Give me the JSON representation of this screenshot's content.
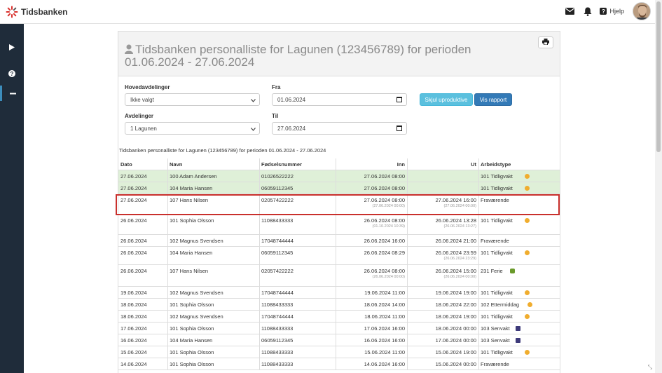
{
  "header": {
    "brand": "Tidsbanken",
    "help_label": "Hjelp",
    "icons": [
      "envelope-icon",
      "bell-icon",
      "question-icon"
    ]
  },
  "sidebar": {
    "icons": [
      "play-icon",
      "question-circle-icon",
      "minus-icon"
    ]
  },
  "report": {
    "title_line1": "Tidsbanken personalliste for Lagunen (123456789) for perioden",
    "title_line2": "01.06.2024 - 27.06.2024",
    "caption": "Tidsbanken personalliste for Lagunen (123456789) for perioden 01.06.2024 - 27.06.2024"
  },
  "filters": {
    "hoved_label": "Hovedavdelinger",
    "hoved_value": "Ikke valgt",
    "avd_label": "Avdelinger",
    "avd_value": "1 Lagunen",
    "fra_label": "Fra",
    "fra_value": "01.06.2024",
    "til_label": "Til",
    "til_value": "27.06.2024",
    "btn_hide": "Skjul uproduktive",
    "btn_show": "Vis rapport"
  },
  "table": {
    "headers": {
      "dato": "Dato",
      "navn": "Navn",
      "fnr": "Fødselsnummer",
      "inn": "Inn",
      "ut": "Ut",
      "type": "Arbeidstype"
    },
    "rows": [
      {
        "dato": "27.06.2024",
        "navn": "100 Adam Andersen",
        "fnr": "01026522222",
        "inn": "27.06.2024 08:00",
        "inn_sub": "",
        "ut": "",
        "ut_sub": "",
        "type": "101 Tidligvakt",
        "emoji": "sun-icon",
        "green": true
      },
      {
        "dato": "27.06.2024",
        "navn": "104 Maria Hansen",
        "fnr": "06059112345",
        "inn": "27.06.2024 08:00",
        "inn_sub": "",
        "ut": "",
        "ut_sub": "",
        "type": "101 Tidligvakt",
        "emoji": "sun-icon",
        "green": true
      },
      {
        "dato": "27.06.2024",
        "navn": "107 Hans Nilsen",
        "fnr": "02057422222",
        "inn": "27.06.2024 08:00",
        "inn_sub": "(27.06.2024 00:00)",
        "ut": "27.06.2024 16:00",
        "ut_sub": "(27.06.2024 00:00)",
        "type": "Fraværende",
        "emoji": "",
        "green": false
      },
      {
        "dato": "26.06.2024",
        "navn": "101 Sophia Olsson",
        "fnr": "11088433333",
        "inn": "26.06.2024 08:00",
        "inn_sub": "(01.10.2024 10:39)",
        "ut": "26.06.2024 13:28",
        "ut_sub": "(26.06.2024 13:27)",
        "type": "101 Tidligvakt",
        "emoji": "sun-icon",
        "green": false
      },
      {
        "dato": "26.06.2024",
        "navn": "102 Magnus Svendsen",
        "fnr": "17048744444",
        "inn": "26.06.2024 16:00",
        "inn_sub": "",
        "ut": "26.06.2024 21:00",
        "ut_sub": "",
        "type": "Fraværende",
        "emoji": "",
        "green": false
      },
      {
        "dato": "26.06.2024",
        "navn": "104 Maria Hansen",
        "fnr": "06059112345",
        "inn": "26.06.2024 08:29",
        "inn_sub": "",
        "ut": "26.06.2024 23:59",
        "ut_sub": "(26.06.2024 23:29)",
        "type": "101 Tidligvakt",
        "emoji": "sun-icon",
        "green": false
      },
      {
        "dato": "26.06.2024",
        "navn": "107 Hans Nilsen",
        "fnr": "02057422222",
        "inn": "26.06.2024 08:00",
        "inn_sub": "(26.06.2024 00:00)",
        "ut": "26.06.2024 15:00",
        "ut_sub": "(26.06.2024 00:00)",
        "type": "231 Ferie",
        "emoji": "palm-icon",
        "green": false
      },
      {
        "dato": "19.06.2024",
        "navn": "102 Magnus Svendsen",
        "fnr": "17048744444",
        "inn": "19.06.2024 11:00",
        "inn_sub": "",
        "ut": "19.06.2024 19:00",
        "ut_sub": "",
        "type": "101 Tidligvakt",
        "emoji": "sun-icon",
        "green": false
      },
      {
        "dato": "18.06.2024",
        "navn": "101 Sophia Olsson",
        "fnr": "11088433333",
        "inn": "18.06.2024 14:00",
        "inn_sub": "",
        "ut": "18.06.2024 22:00",
        "ut_sub": "",
        "type": "102 Ettermiddag",
        "emoji": "sun-icon",
        "green": false
      },
      {
        "dato": "18.06.2024",
        "navn": "102 Magnus Svendsen",
        "fnr": "17048744444",
        "inn": "18.06.2024 11:00",
        "inn_sub": "",
        "ut": "18.06.2024 19:00",
        "ut_sub": "",
        "type": "101 Tidligvakt",
        "emoji": "sun-icon",
        "green": false
      },
      {
        "dato": "17.06.2024",
        "navn": "101 Sophia Olsson",
        "fnr": "11088433333",
        "inn": "17.06.2024 16:00",
        "inn_sub": "",
        "ut": "18.06.2024 00:00",
        "ut_sub": "",
        "type": "103 Senvakt",
        "emoji": "moon-icon",
        "green": false
      },
      {
        "dato": "16.06.2024",
        "navn": "104 Maria Hansen",
        "fnr": "06059112345",
        "inn": "16.06.2024 16:00",
        "inn_sub": "",
        "ut": "17.06.2024 00:00",
        "ut_sub": "",
        "type": "103 Senvakt",
        "emoji": "moon-icon",
        "green": false
      },
      {
        "dato": "15.06.2024",
        "navn": "101 Sophia Olsson",
        "fnr": "11088433333",
        "inn": "15.06.2024 11:00",
        "inn_sub": "",
        "ut": "15.06.2024 19:00",
        "ut_sub": "",
        "type": "101 Tidligvakt",
        "emoji": "sun-icon",
        "green": false
      },
      {
        "dato": "14.06.2024",
        "navn": "101 Sophia Olsson",
        "fnr": "11088433333",
        "inn": "14.06.2024 16:00",
        "inn_sub": "",
        "ut": "15.06.2024 00:00",
        "ut_sub": "",
        "type": "Fraværende",
        "emoji": "",
        "green": false
      }
    ]
  },
  "colors": {
    "sidebar": "#1f2c3a",
    "green_row": "#dff0d8",
    "highlight": "#c9302c",
    "btn_info": "#5bc0de",
    "btn_primary": "#337ab7"
  }
}
